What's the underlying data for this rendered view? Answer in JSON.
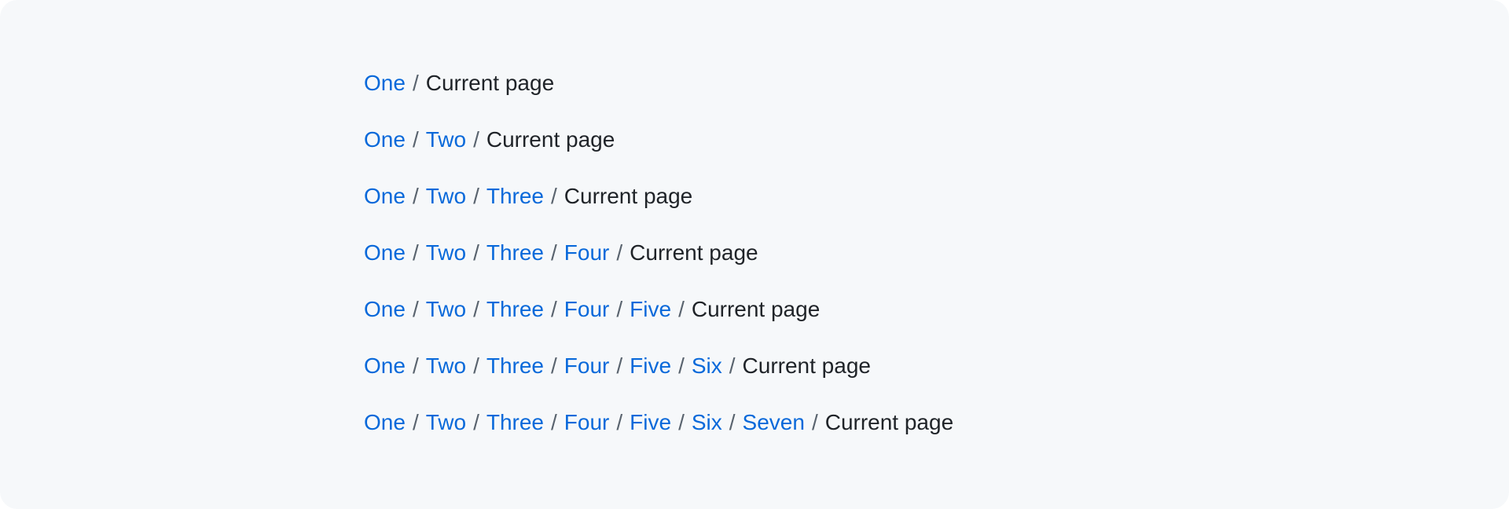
{
  "colors": {
    "background": "#f6f8fa",
    "link": "#0969da",
    "separator": "#59636e",
    "current": "#1f2328"
  },
  "separator": "/",
  "current_label": "Current page",
  "breadcrumbs": [
    {
      "links": [
        "One"
      ],
      "current": "Current page"
    },
    {
      "links": [
        "One",
        "Two"
      ],
      "current": "Current page"
    },
    {
      "links": [
        "One",
        "Two",
        "Three"
      ],
      "current": "Current page"
    },
    {
      "links": [
        "One",
        "Two",
        "Three",
        "Four"
      ],
      "current": "Current page"
    },
    {
      "links": [
        "One",
        "Two",
        "Three",
        "Four",
        "Five"
      ],
      "current": "Current page"
    },
    {
      "links": [
        "One",
        "Two",
        "Three",
        "Four",
        "Five",
        "Six"
      ],
      "current": "Current page"
    },
    {
      "links": [
        "One",
        "Two",
        "Three",
        "Four",
        "Five",
        "Six",
        "Seven"
      ],
      "current": "Current page"
    }
  ]
}
